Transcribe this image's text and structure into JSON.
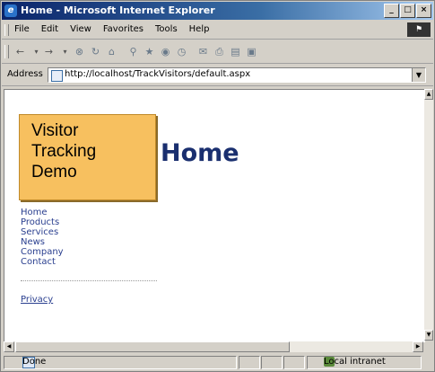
{
  "window": {
    "title": "Home - Microsoft Internet Explorer"
  },
  "menu": [
    "File",
    "Edit",
    "View",
    "Favorites",
    "Tools",
    "Help"
  ],
  "address": {
    "label": "Address",
    "url": "http://localhost/TrackVisitors/default.aspx"
  },
  "page": {
    "logo_lines": [
      "Visitor",
      "Tracking",
      "Demo"
    ],
    "heading": "Home",
    "nav": [
      "Home",
      "Products",
      "Services",
      "News",
      "Company",
      "Contact"
    ],
    "privacy": "Privacy"
  },
  "status": {
    "text": "Done",
    "zone": "Local intranet"
  },
  "icons": {
    "back": "back-icon",
    "forward": "forward-icon",
    "stop": "stop-icon",
    "refresh": "refresh-icon",
    "home": "home-icon",
    "search": "search-icon",
    "favorites": "favorites-icon",
    "history": "history-icon",
    "mail": "mail-icon",
    "print": "print-icon",
    "edit": "edit-icon",
    "discuss": "discuss-icon"
  }
}
